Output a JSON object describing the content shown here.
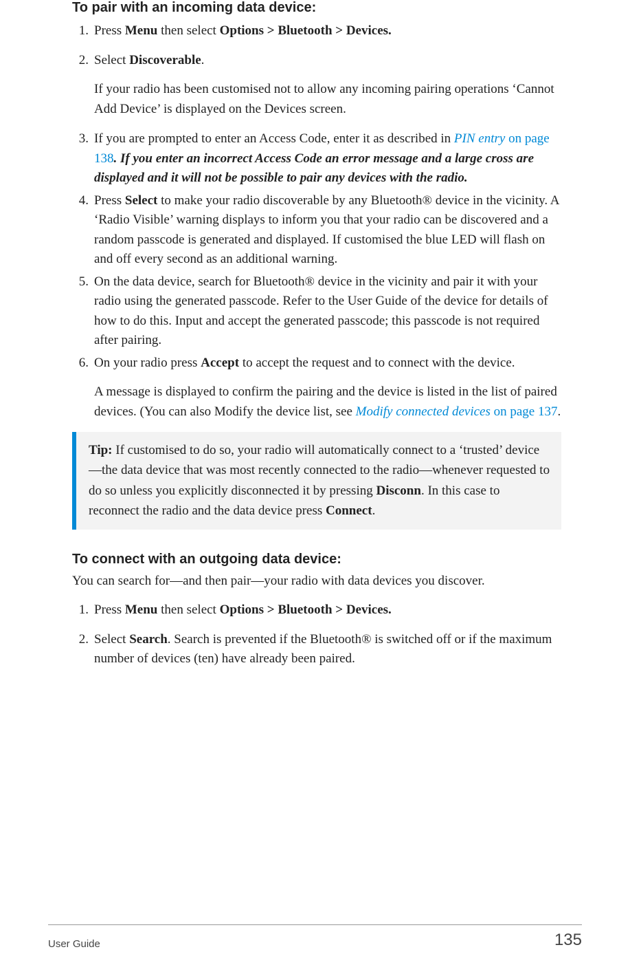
{
  "section1": {
    "heading": "To pair with an incoming data device:",
    "items": {
      "i1": {
        "num": "1.",
        "t_before": "Press ",
        "t_menu": "Menu",
        "t_mid": " then select ",
        "t_path": "Options > Bluetooth > Devices."
      },
      "i2": {
        "num": "2.",
        "t_before": "Select ",
        "t_disc": "Discoverable",
        "t_after": ".",
        "para": "If your radio has been customised not to allow any incoming pairing operations ‘Cannot Add Device’ is displayed on the Devices screen."
      },
      "i3": {
        "num": "3.",
        "t_before": "If you are prompted to enter an Access Code, enter it as described in ",
        "link_em": "PIN entry",
        "link_plain": " on page 138",
        "t_dot": ". ",
        "t_bolditalic": "If you enter an incorrect Access Code an error message and a large cross are displayed and it will not be possible to pair any devices with the radio."
      },
      "i4": {
        "num": "4.",
        "t_before": "Press ",
        "t_select": "Select",
        "t_after": " to make your radio discoverable by any Bluetooth® device in the vicinity. A ‘Radio Visible’ warning displays to inform you that your radio can be discovered and a random passcode is generated and displayed. If customised the blue LED will flash on and off every second as an additional warning."
      },
      "i5": {
        "num": "5.",
        "t": "On the data device, search for Bluetooth® device in the vicinity and pair it with your radio using the generated passcode. Refer to the User Guide of the device for details of how to do this. Input and accept the generated passcode; this passcode is not required after pairing."
      },
      "i6": {
        "num": "6.",
        "t_before": "On your radio press ",
        "t_accept": "Accept",
        "t_after": " to accept the request and to connect with the device.",
        "para_before": "A message is displayed to confirm the pairing and the device is listed in the list of paired devices. (You can also Modify the device list, see ",
        "para_link_em": "Modify connected devices",
        "para_link_plain": " on page 137",
        "para_after": "."
      }
    },
    "tip": {
      "label": "Tip:",
      "t1": "  If customised to do so, your radio will automatically connect to a ‘trusted’ device—the data device that was most recently connected to the radio—whenever requested to do so unless you explicitly disconnected it by pressing ",
      "b1": "Disconn",
      "t2": ". In this case to reconnect the radio and the data device press ",
      "b2": "Connect",
      "t3": "."
    }
  },
  "section2": {
    "heading": "To connect with an outgoing data device:",
    "intro": "You can search for—and then pair—your radio with data devices you discover.",
    "items": {
      "i1": {
        "num": "1.",
        "t_before": "Press ",
        "t_menu": "Menu",
        "t_mid": " then select ",
        "t_path": "Options > Bluetooth > Devices."
      },
      "i2": {
        "num": "2.",
        "t_before": "Select ",
        "t_search": "Search",
        "t_after": ". Search is prevented if the Bluetooth® is switched off or if the maximum number of devices (ten) have already been paired."
      }
    }
  },
  "footer": {
    "left": "User Guide",
    "right": "135"
  }
}
